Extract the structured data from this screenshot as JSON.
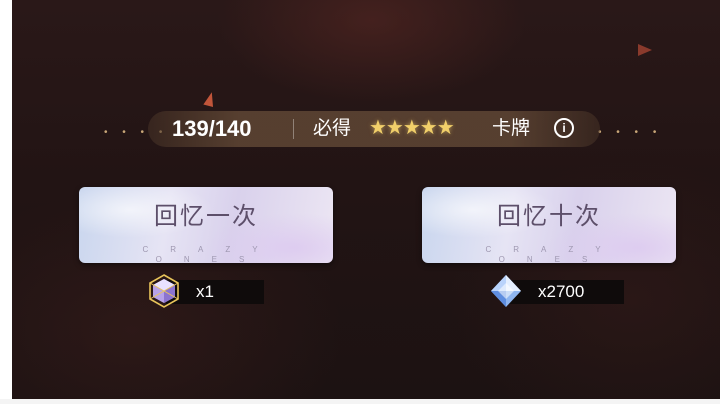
{
  "pity": {
    "count": "139/140",
    "label": "必得",
    "stars": "★★★★★",
    "star_count": 5,
    "suffix": "卡牌",
    "info_icon": "info-icon"
  },
  "draw_once": {
    "title": "回忆一次",
    "subtitle": "CRAZY ONES",
    "cost_icon": "purple-crystal-icon",
    "cost": "x1"
  },
  "draw_ten": {
    "title": "回忆十次",
    "subtitle": "CRAZY ONES",
    "cost_icon": "blue-diamond-icon",
    "cost": "x2700"
  },
  "colors": {
    "background": "#221414",
    "star": "#f1cf6a",
    "button_text": "#5d4f6a",
    "accent_triangle": "#c1553a"
  }
}
